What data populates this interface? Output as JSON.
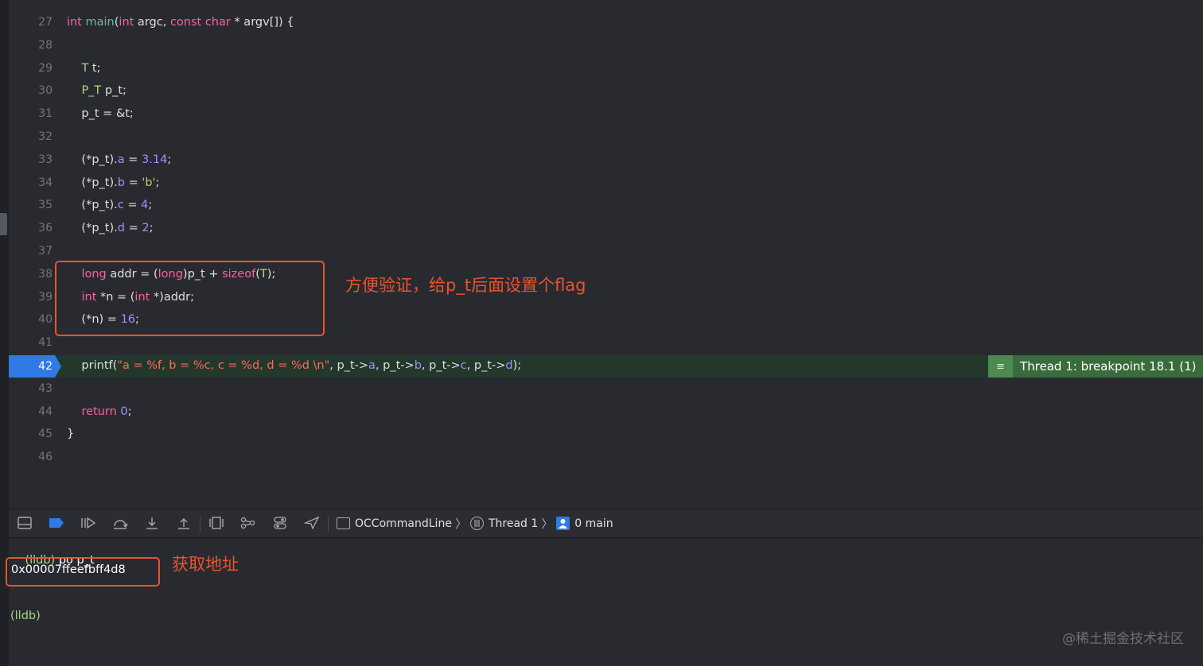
{
  "editor": {
    "lines": [
      {
        "num": "27",
        "tokens": [
          [
            "kw",
            "int"
          ],
          [
            "p",
            " "
          ],
          [
            "fn",
            "main"
          ],
          [
            "p",
            "("
          ],
          [
            "kw",
            "int"
          ],
          [
            "p",
            " argc, "
          ],
          [
            "kw",
            "const"
          ],
          [
            "p",
            " "
          ],
          [
            "kw",
            "char"
          ],
          [
            "p",
            " * argv[]) {"
          ]
        ]
      },
      {
        "num": "28",
        "tokens": []
      },
      {
        "num": "29",
        "tokens": [
          [
            "p",
            "    "
          ],
          [
            "ty",
            "T"
          ],
          [
            "p",
            " t;"
          ]
        ]
      },
      {
        "num": "30",
        "tokens": [
          [
            "p",
            "    "
          ],
          [
            "ty",
            "P_T"
          ],
          [
            "p",
            " p_t;"
          ]
        ]
      },
      {
        "num": "31",
        "tokens": [
          [
            "p",
            "    p_t = &t;"
          ]
        ]
      },
      {
        "num": "32",
        "tokens": []
      },
      {
        "num": "33",
        "tokens": [
          [
            "p",
            "    (*p_t)."
          ],
          [
            "mem",
            "a"
          ],
          [
            "p",
            " = "
          ],
          [
            "num",
            "3.14"
          ],
          [
            "p",
            ";"
          ]
        ]
      },
      {
        "num": "34",
        "tokens": [
          [
            "p",
            "    (*p_t)."
          ],
          [
            "mem",
            "b"
          ],
          [
            "p",
            " = "
          ],
          [
            "lit",
            "'b'"
          ],
          [
            "p",
            ";"
          ]
        ]
      },
      {
        "num": "35",
        "tokens": [
          [
            "p",
            "    (*p_t)."
          ],
          [
            "mem",
            "c"
          ],
          [
            "p",
            " = "
          ],
          [
            "num",
            "4"
          ],
          [
            "p",
            ";"
          ]
        ]
      },
      {
        "num": "36",
        "tokens": [
          [
            "p",
            "    (*p_t)."
          ],
          [
            "mem",
            "d"
          ],
          [
            "p",
            " = "
          ],
          [
            "num",
            "2"
          ],
          [
            "p",
            ";"
          ]
        ]
      },
      {
        "num": "37",
        "tokens": []
      },
      {
        "num": "38",
        "tokens": [
          [
            "p",
            "    "
          ],
          [
            "kw",
            "long"
          ],
          [
            "p",
            " addr = ("
          ],
          [
            "kw",
            "long"
          ],
          [
            "p",
            ")p_t + "
          ],
          [
            "kw",
            "sizeof"
          ],
          [
            "p",
            "("
          ],
          [
            "ty",
            "T"
          ],
          [
            "p",
            ");"
          ]
        ]
      },
      {
        "num": "39",
        "tokens": [
          [
            "p",
            "    "
          ],
          [
            "kw",
            "int"
          ],
          [
            "p",
            " *n = ("
          ],
          [
            "kw",
            "int"
          ],
          [
            "p",
            " *)addr;"
          ]
        ]
      },
      {
        "num": "40",
        "tokens": [
          [
            "p",
            "    (*n) = "
          ],
          [
            "num",
            "16"
          ],
          [
            "p",
            ";"
          ]
        ]
      },
      {
        "num": "41",
        "tokens": []
      },
      {
        "num": "42",
        "tokens": [
          [
            "p",
            "    printf("
          ],
          [
            "str",
            "\"a = %f, b = %c, c = %d, d = %d \\n\""
          ],
          [
            "p",
            ", p_t->"
          ],
          [
            "mem",
            "a"
          ],
          [
            "p",
            ", p_t->"
          ],
          [
            "mem",
            "b"
          ],
          [
            "p",
            ", p_t->"
          ],
          [
            "mem",
            "c"
          ],
          [
            "p",
            ", p_t->"
          ],
          [
            "mem",
            "d"
          ],
          [
            "p",
            ");"
          ]
        ]
      },
      {
        "num": "43",
        "tokens": []
      },
      {
        "num": "44",
        "tokens": [
          [
            "p",
            "    "
          ],
          [
            "kw",
            "return"
          ],
          [
            "p",
            " "
          ],
          [
            "num",
            "0"
          ],
          [
            "p",
            ";"
          ]
        ]
      },
      {
        "num": "45",
        "tokens": [
          [
            "p",
            "}"
          ]
        ]
      },
      {
        "num": "46",
        "tokens": []
      }
    ],
    "breakpoint_line_number": "42",
    "breakpoint_badge": "Thread 1: breakpoint 18.1 (1)",
    "breakpoint_badge_icon": "≡"
  },
  "annotations": {
    "code_note": "方便验证，给p_t后面设置个flag",
    "console_note": "获取地址"
  },
  "debug_bar": {
    "icons": [
      "hide-console-icon",
      "breakpoints-toggle-icon",
      "continue-icon",
      "step-over-icon",
      "step-into-icon",
      "step-out-icon",
      "view-hierarchy-icon",
      "memory-graph-icon",
      "environment-overrides-icon",
      "simulate-location-icon"
    ],
    "crumbs": {
      "target": "OCCommandLine",
      "thread": "Thread 1",
      "frame": "0 main"
    }
  },
  "console": {
    "prompt": "(lldb)",
    "command": " po p_t",
    "output": "0x00007ffeefbff4d8",
    "prompt2": "(lldb)"
  },
  "watermark": "@稀土掘金技术社区",
  "colors": {
    "keyword": "#fc5fa3",
    "type": "#a3d97c",
    "string": "#fc6a5d",
    "number": "#a090ff",
    "breakpoint": "#2f7ae5",
    "annotation": "#e8542d"
  }
}
